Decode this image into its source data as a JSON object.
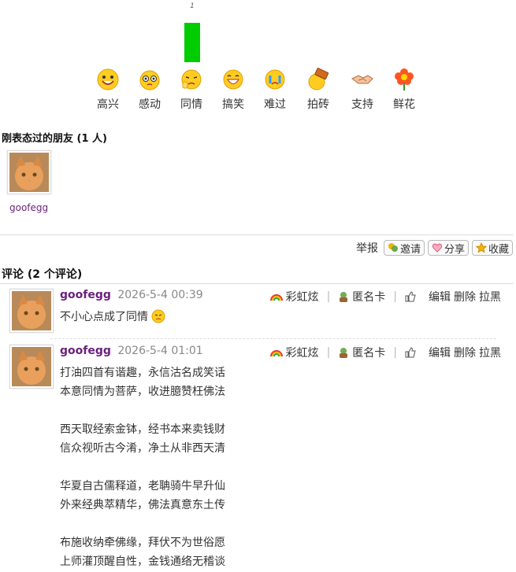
{
  "chart_data": {
    "type": "bar",
    "categories": [
      "高兴",
      "感动",
      "同情",
      "搞笑",
      "难过",
      "拍砖",
      "支持",
      "鲜花"
    ],
    "values": [
      0,
      0,
      1,
      0,
      0,
      0,
      0,
      0
    ],
    "data_label": "1",
    "colors": {
      "bar": "#00cc00"
    }
  },
  "moods": [
    {
      "label": "高兴",
      "icon": "happy-face-icon"
    },
    {
      "label": "感动",
      "icon": "touched-face-icon"
    },
    {
      "label": "同情",
      "icon": "sympathy-face-icon"
    },
    {
      "label": "搞笑",
      "icon": "laughing-face-icon"
    },
    {
      "label": "难过",
      "icon": "crying-face-icon"
    },
    {
      "label": "拍砖",
      "icon": "brick-icon"
    },
    {
      "label": "支持",
      "icon": "handshake-icon"
    },
    {
      "label": "鲜花",
      "icon": "flower-icon"
    }
  ],
  "friends": {
    "title": "刚表态过的朋友 (1 人)",
    "items": [
      {
        "name": "goofegg"
      }
    ]
  },
  "actions": {
    "report": "举报",
    "invite": "邀请",
    "share": "分享",
    "favorite": "收藏"
  },
  "comments": {
    "title": "评论 (2 个评论)",
    "tools": {
      "rainbow": "彩虹炫",
      "anon": "匿名卡",
      "edit": "编辑",
      "delete": "删除",
      "block": "拉黑"
    },
    "items": [
      {
        "user": "goofegg",
        "time": "2026-5-4 00:39",
        "text": "不小心点成了同情"
      },
      {
        "user": "goofegg",
        "time": "2026-5-4 01:01",
        "text": "打油四首有谐趣，永信沽名成笑话\n本意同情为菩萨，收进臆赞枉佛法\n\n西天取经索金钵，经书本来卖钱财\n信众视听古今淆，净土从非西天清\n\n华夏自古儒释道，老聃骑牛早升仙\n外来经典萃精华，佛法真意东土传\n\n布施收纳牵佛缘，拜伏不为世俗愿\n上师灌顶醒自性，金钱通络无稽谈"
      }
    ]
  },
  "colors": {
    "accent": "#6b1f7c",
    "bar": "#00cc00"
  }
}
